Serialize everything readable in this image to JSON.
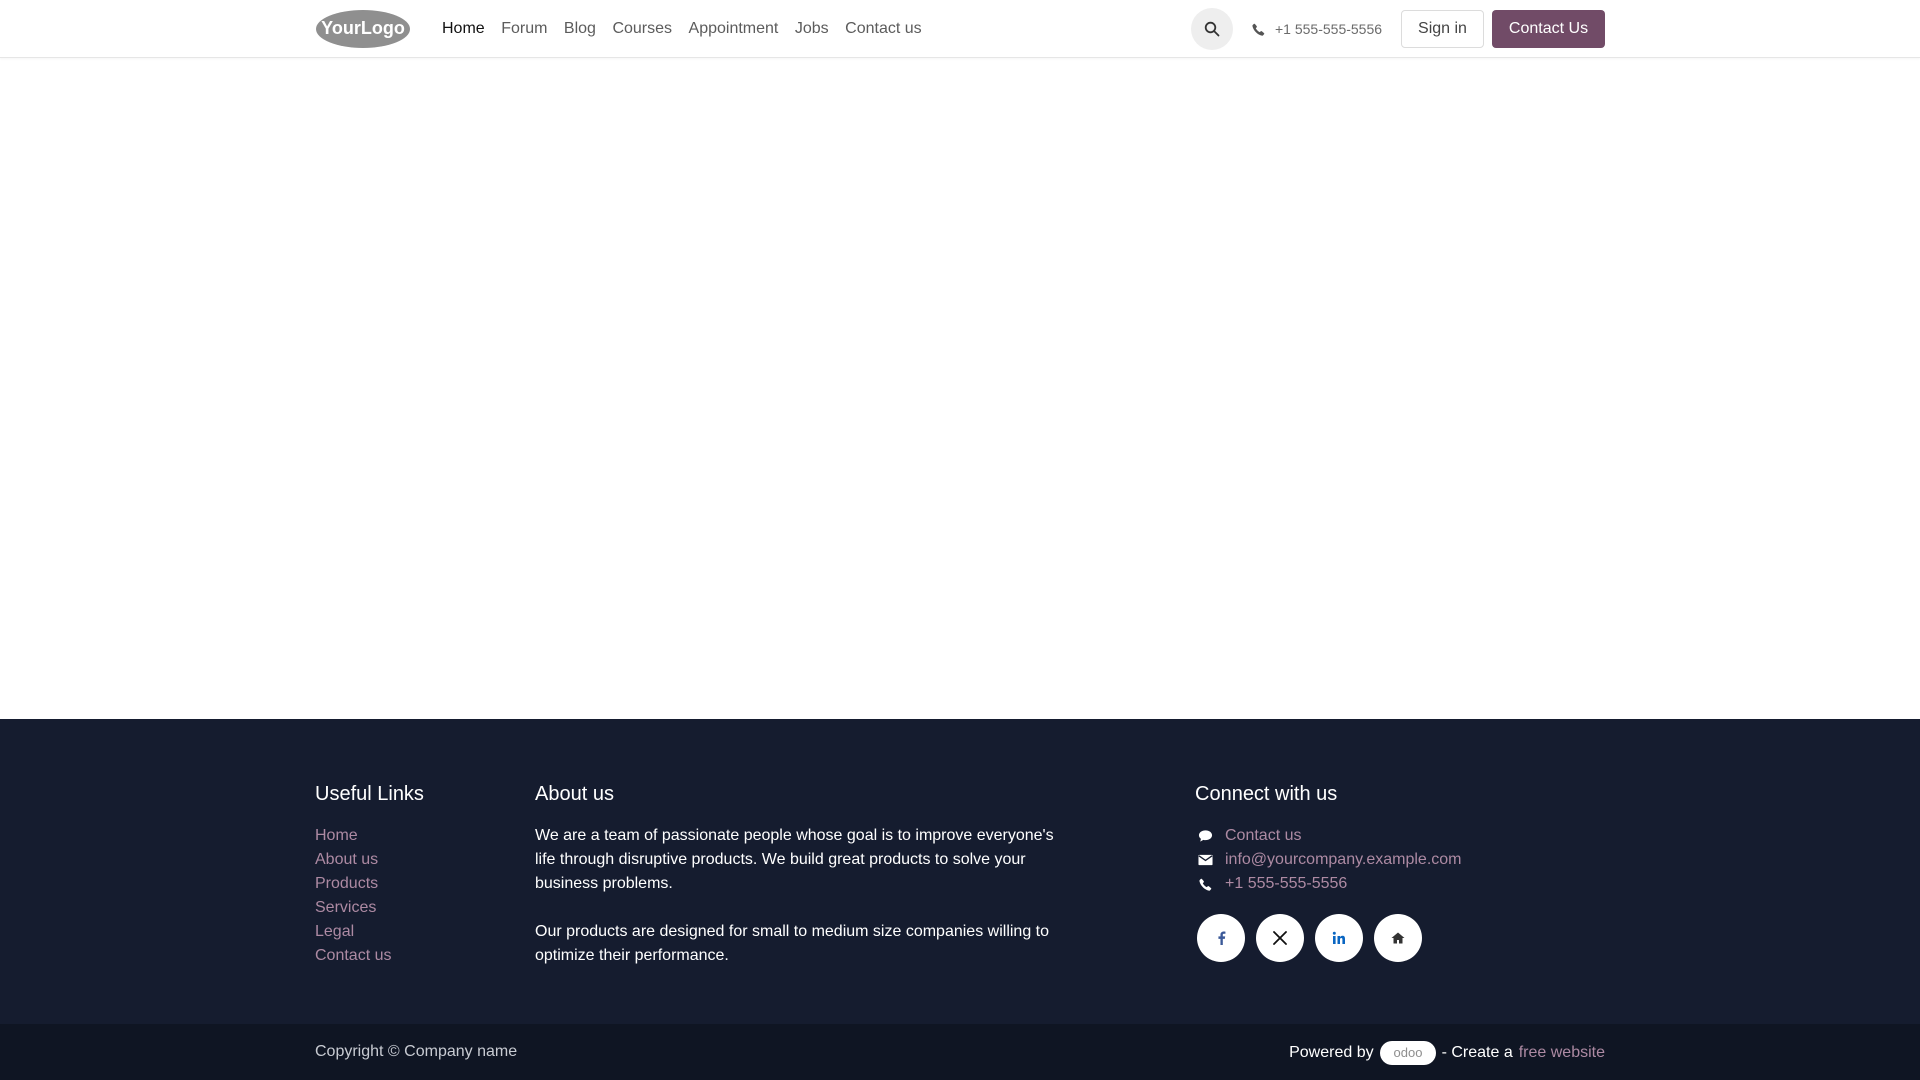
{
  "header": {
    "logo_text": "YourLogo",
    "nav": [
      {
        "label": "Home",
        "active": true
      },
      {
        "label": "Forum",
        "active": false
      },
      {
        "label": "Blog",
        "active": false
      },
      {
        "label": "Courses",
        "active": false
      },
      {
        "label": "Appointment",
        "active": false
      },
      {
        "label": "Jobs",
        "active": false
      },
      {
        "label": "Contact us",
        "active": false
      }
    ],
    "phone": "+1 555-555-5556",
    "signin_label": "Sign in",
    "contact_label": "Contact Us"
  },
  "footer": {
    "useful_links": {
      "title": "Useful Links",
      "items": [
        "Home",
        "About us",
        "Products",
        "Services",
        "Legal",
        "Contact us"
      ]
    },
    "about": {
      "title": "About us",
      "paragraph1": "We are a team of passionate people whose goal is to improve everyone's life through disruptive products. We build great products to solve your business problems.",
      "paragraph2": "Our products are designed for small to medium size companies willing to optimize their performance."
    },
    "connect": {
      "title": "Connect with us",
      "contact": "Contact us",
      "email": "info@yourcompany.example.com",
      "phone": "+1 555-555-5556",
      "socials": [
        "facebook-icon",
        "x-icon",
        "linkedin-icon",
        "home-icon"
      ]
    },
    "copyright": "Copyright © Company name",
    "powered_by": "Powered by",
    "odoo_logo": "odoo",
    "create_text": "- Create a",
    "free_website": "free website"
  },
  "colors": {
    "brand": "#714b67",
    "footer_bg": "#151c2f",
    "link": "#ad8aa3"
  }
}
